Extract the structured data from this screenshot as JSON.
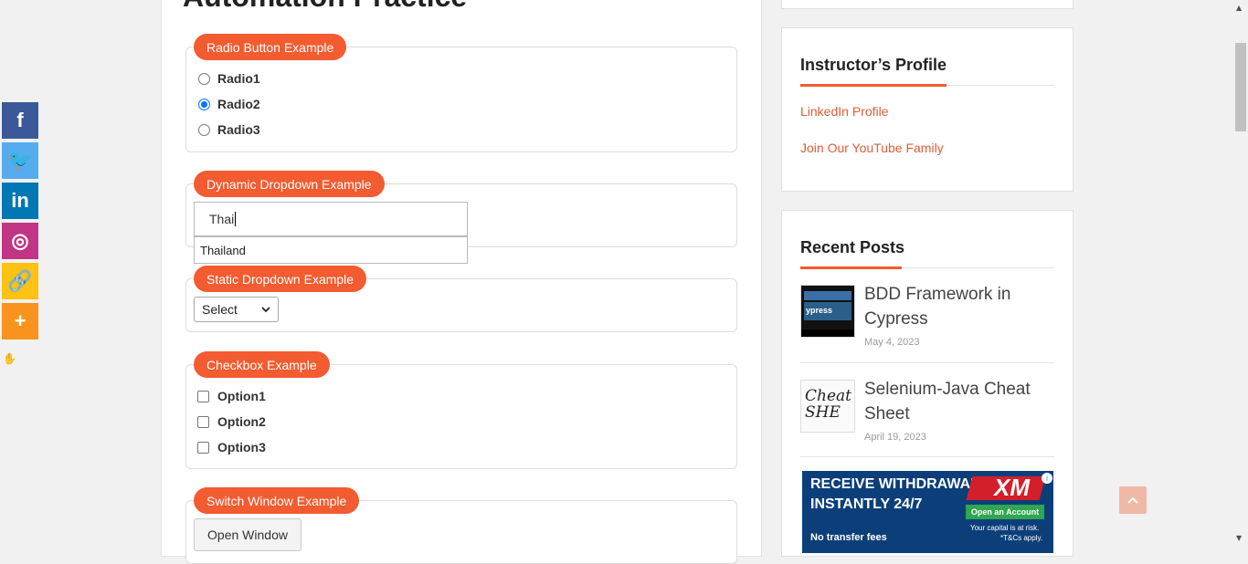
{
  "share_bar": {
    "buttons": [
      {
        "icon": "facebook-icon",
        "glyph": "f",
        "color": "#3b5998"
      },
      {
        "icon": "twitter-icon",
        "glyph": "🐦",
        "color": "#55acee"
      },
      {
        "icon": "linkedin-icon",
        "glyph": "in",
        "color": "#0077b5"
      },
      {
        "icon": "instagram-icon",
        "glyph": "◎",
        "color": "#c13584"
      },
      {
        "icon": "copy-link-icon",
        "glyph": "🔗",
        "color": "#ffc112"
      },
      {
        "icon": "more-icon",
        "glyph": "+",
        "color": "#f8941d"
      }
    ],
    "hide_glyph": "✋"
  },
  "page": {
    "heading": "Automation Practice"
  },
  "radio_section": {
    "legend": "Radio Button Example",
    "options": [
      "Radio1",
      "Radio2",
      "Radio3"
    ],
    "selected": "Radio2"
  },
  "dropdown_section": {
    "legend": "Dynamic Dropdown Example",
    "input_value": "Thai",
    "suggestion": "Thailand"
  },
  "static_section": {
    "legend": "Static Dropdown Example",
    "selected": "Select"
  },
  "checkbox_section": {
    "legend": "Checkbox Example",
    "options": [
      "Option1",
      "Option2",
      "Option3"
    ]
  },
  "switch_section": {
    "legend": "Switch Window Example",
    "button_label": "Open Window"
  },
  "sidebar": {
    "instructor": {
      "title": "Instructor’s Profile",
      "links": [
        "LinkedIn Profile",
        "Join Our YouTube Family"
      ]
    },
    "recent_posts": {
      "title": "Recent Posts",
      "posts": [
        {
          "title": "BDD Framework in Cypress",
          "date": "May 4, 2023",
          "thumb_text": "ypress"
        },
        {
          "title": "Selenium-Java Cheat Sheet",
          "date": "April 19, 2023",
          "thumb_text": "Cheat SHE"
        }
      ]
    },
    "ad": {
      "line1": "RECEIVE WITHDRAWALS",
      "line2": "INSTANTLY 24/7",
      "brand": "XM",
      "cta": "Open an Account",
      "footer": "No transfer fees",
      "risk": "Your capital is at risk.",
      "tc": "*T&Cs apply."
    }
  },
  "colors": {
    "accent": "#f35b30",
    "link": "#e05b34"
  }
}
